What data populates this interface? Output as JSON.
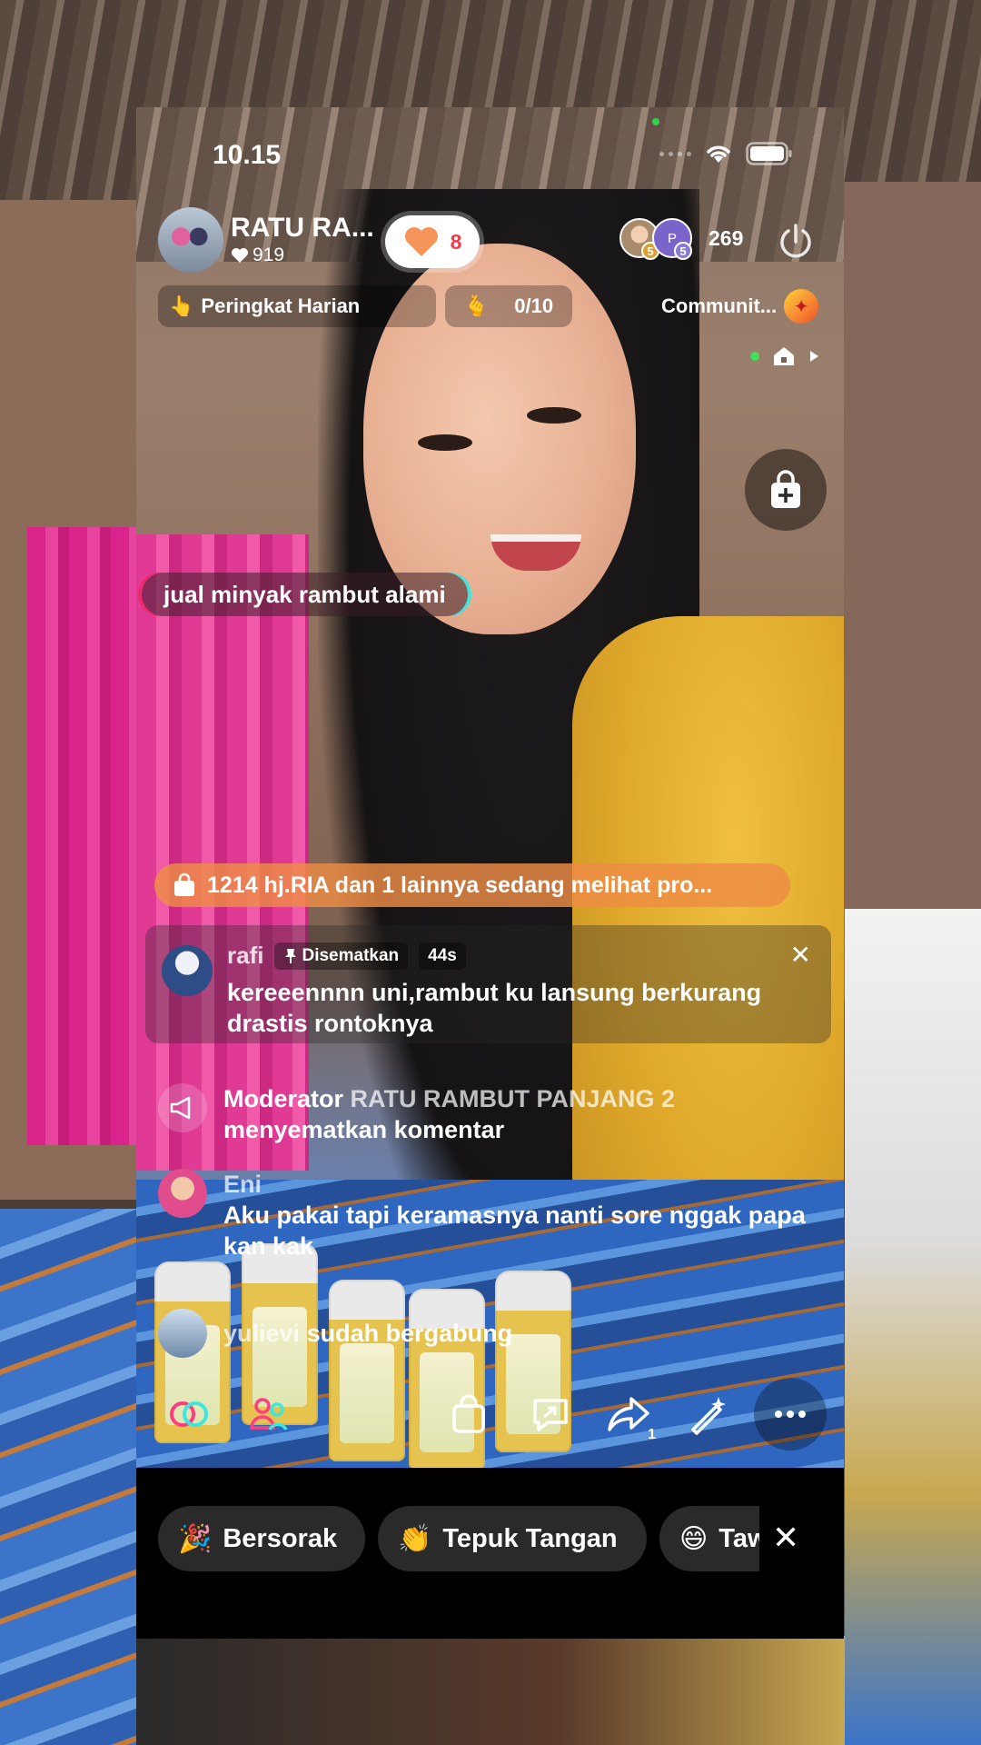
{
  "status": {
    "time": "10.15"
  },
  "host": {
    "name": "RATU RA...",
    "likes": "919"
  },
  "heart_count": "8",
  "viewers": {
    "count": "269",
    "badge1": "5",
    "badge2": "5",
    "avatar2_label": "P"
  },
  "chips": {
    "rank": "Peringkat Harian",
    "goal": "0/10",
    "community": "Communit..."
  },
  "topic": "jual minyak rambut alami",
  "watching_banner": "1214 hj.RIA dan 1 lainnya sedang melihat pro...",
  "pinned": {
    "user": "rafi",
    "tag": "Disematkan",
    "age": "44s",
    "text": "kereeennnn uni,rambut ku lansung berkurang drastis rontoknya"
  },
  "feed": [
    {
      "prefix": "Moderator",
      "who": "RATU RAMBUT PANJANG 2",
      "text": "menyematkan komentar"
    },
    {
      "who": "Eni",
      "text": "Aku pakai tapi keramasnya nanti sore nggak papa kan kak"
    },
    {
      "who": "yulievi",
      "text": "sudah bergabung"
    }
  ],
  "share_count": "1",
  "reactions": [
    "Bersorak",
    "Tepuk Tangan",
    "Tawa"
  ],
  "colors": {
    "heart": "#ee3b4b",
    "accent_pink": "#ee2a6a",
    "accent_cyan": "#3ee6e0",
    "banner": "#ee8c46"
  },
  "icons": [
    "wifi-icon",
    "battery-icon",
    "power-icon",
    "heart-icon",
    "shopping-bag-icon",
    "pin-icon",
    "megaphone-icon",
    "close-icon",
    "share-icon",
    "more-icon"
  ]
}
